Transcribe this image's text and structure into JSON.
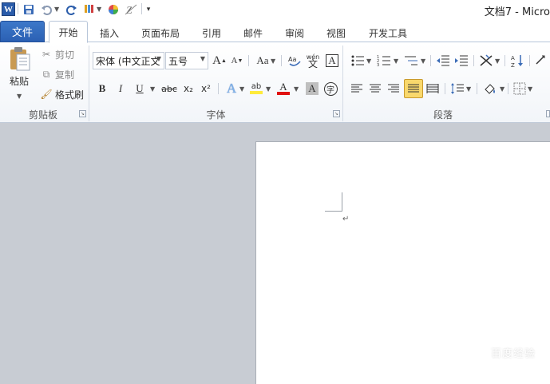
{
  "window": {
    "title": "文档7 - Micro"
  },
  "quick_access": {
    "logo_letter": "W",
    "items": [
      "save-icon",
      "undo-icon",
      "redo-icon",
      "format-painter-icon",
      "color-wheel-icon",
      "clear-format-icon",
      "customize-icon"
    ]
  },
  "tabs": {
    "file": "文件",
    "home": "开始",
    "insert": "插入",
    "layout": "页面布局",
    "references": "引用",
    "mailings": "邮件",
    "review": "审阅",
    "view": "视图",
    "developer": "开发工具"
  },
  "clipboard": {
    "paste": "粘贴",
    "cut": "剪切",
    "copy": "复制",
    "format_painter": "格式刷",
    "group_label": "剪贴板"
  },
  "font": {
    "font_name": "宋体 (中文正文",
    "font_size": "五号",
    "grow": "A",
    "shrink": "A",
    "change_case": "Aa",
    "phonetic": "wén",
    "phonetic_char": "文",
    "border_char": "A",
    "bold": "B",
    "italic": "I",
    "underline": "U",
    "strikethrough": "abc",
    "subscript": "x₂",
    "superscript": "x²",
    "text_effects": "A",
    "highlight": "ab",
    "font_color": "A",
    "char_shading": "A",
    "enclose": "字",
    "group_label": "字体"
  },
  "paragraph": {
    "group_label": "段落"
  },
  "document": {
    "watermark": "百度经验"
  },
  "colors": {
    "accent": "#2b60b3",
    "highlight_yellow": "#ffeb3b",
    "font_red": "#e01010",
    "active_button": "#f9d86c",
    "workspace": "#c8ccd3"
  }
}
